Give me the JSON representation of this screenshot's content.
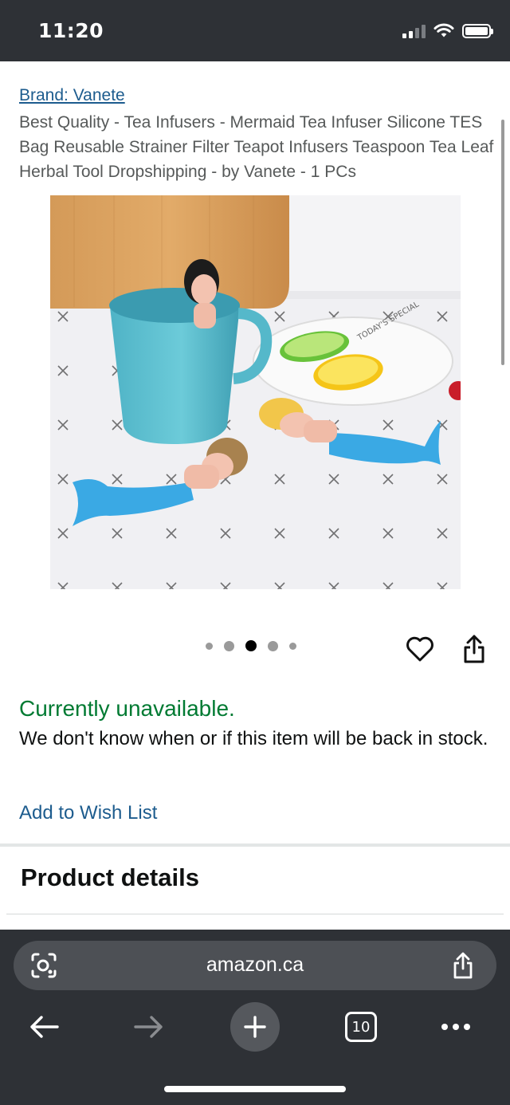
{
  "status_bar": {
    "time": "11:20"
  },
  "product": {
    "brand": "Brand: Vanete",
    "title": "Best Quality - Tea Infusers - Mermaid Tea Infuser Silicone TES Bag Reusable Strainer Filter Teapot Infusers Teaspoon Tea Leaf Herbal Tool Dropshipping - by Vanete - 1 PCs",
    "image_caption": "TODAY'S SPECIAL",
    "image_dots": {
      "count": 5,
      "active_index": 2
    }
  },
  "availability": {
    "status": "Currently unavailable.",
    "message": "We don't know when or if this item will be back in stock.",
    "wishlist": "Add to Wish List"
  },
  "section": {
    "title": "Product details"
  },
  "browser": {
    "url": "amazon.ca",
    "tab_count": "10"
  },
  "icons": {
    "wishlist_icon": "heart-icon",
    "share_icon": "share-icon",
    "lens_icon": "camera-search-icon",
    "back_icon": "arrow-left-icon",
    "forward_icon": "arrow-right-icon",
    "new_tab_icon": "plus-icon",
    "more_icon": "more-icon"
  },
  "colors": {
    "link": "#1d5c8e",
    "availability": "#007a32",
    "chrome": "#2e3136"
  }
}
